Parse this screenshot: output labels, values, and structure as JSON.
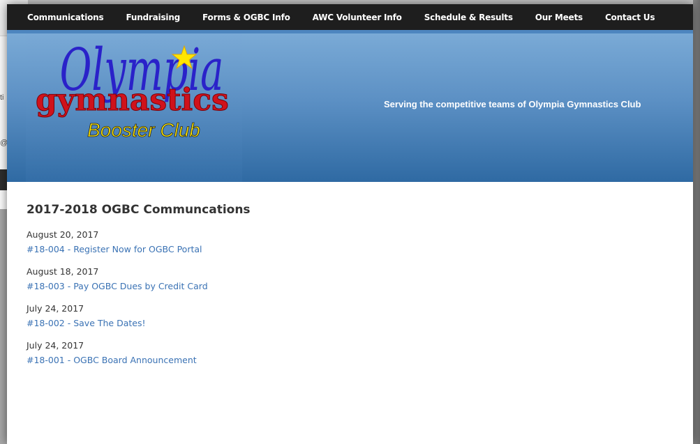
{
  "background_window": {
    "fragments": [
      "ti",
      "@"
    ]
  },
  "nav": {
    "items": [
      {
        "label": "Communications"
      },
      {
        "label": "Fundraising"
      },
      {
        "label": "Forms & OGBC Info"
      },
      {
        "label": "AWC Volunteer Info"
      },
      {
        "label": "Schedule & Results"
      },
      {
        "label": "Our Meets"
      },
      {
        "label": "Contact Us"
      }
    ]
  },
  "header": {
    "logo": {
      "line1": "Olympia",
      "line2": "gymnastics",
      "line3": "Booster Club"
    },
    "tagline": "Serving the competitive teams of Olympia Gymnastics Club"
  },
  "main": {
    "title": "2017-2018 OGBC Communcations",
    "entries": [
      {
        "date": "August 20, 2017",
        "link": "#18-004 - Register Now for OGBC Portal"
      },
      {
        "date": "August 18, 2017",
        "link": "#18-003 - Pay OGBC Dues by Credit Card"
      },
      {
        "date": "July 24, 2017",
        "link": "#18-002 - Save The Dates!"
      },
      {
        "date": "July 24, 2017",
        "link": "#18-001 - OGBC Board Announcement"
      }
    ]
  },
  "colors": {
    "nav_bg": "#1e1e1e",
    "header_top": "#7aaad6",
    "header_bottom": "#2f6aa3",
    "link": "#3a72b4",
    "logo_red": "#d0121b",
    "logo_yellow": "#ffe600",
    "logo_blue": "#2a22c9"
  }
}
